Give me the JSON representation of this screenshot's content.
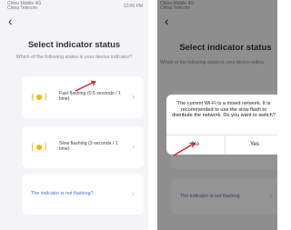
{
  "left": {
    "status_left": "China Mobile 4G\nChina Telecom",
    "status_right": "12:06 PM",
    "back_glyph": "‹",
    "title": "Select indicator status",
    "subtitle": "Which of the following states is your device indicator?",
    "options": [
      {
        "label": "Fast flashing (0.5 seconds / 1 time)"
      },
      {
        "label": "Slow flashing (3 seconds / 1 time)"
      }
    ],
    "not_flashing": "The indicator is not flashing?",
    "chevron": "›",
    "annotation_color": "#e02020",
    "accent_color": "#f5b700",
    "link_color": "#4a6fd0"
  },
  "right": {
    "status_left": "China Mobile 4G\nChina Telecom",
    "back_glyph": "‹",
    "title": "Select indicator status",
    "subtitle": "Which of the following states is your device indica",
    "not_flashing": "The indicator is not flashing",
    "chevron": "›",
    "dialog": {
      "message": "The current Wi-Fi is a mixed network. It is recommended to use the slow flash to distribute the network. Do you want to switch?",
      "no_label": "No",
      "yes_label": "Yes"
    }
  }
}
